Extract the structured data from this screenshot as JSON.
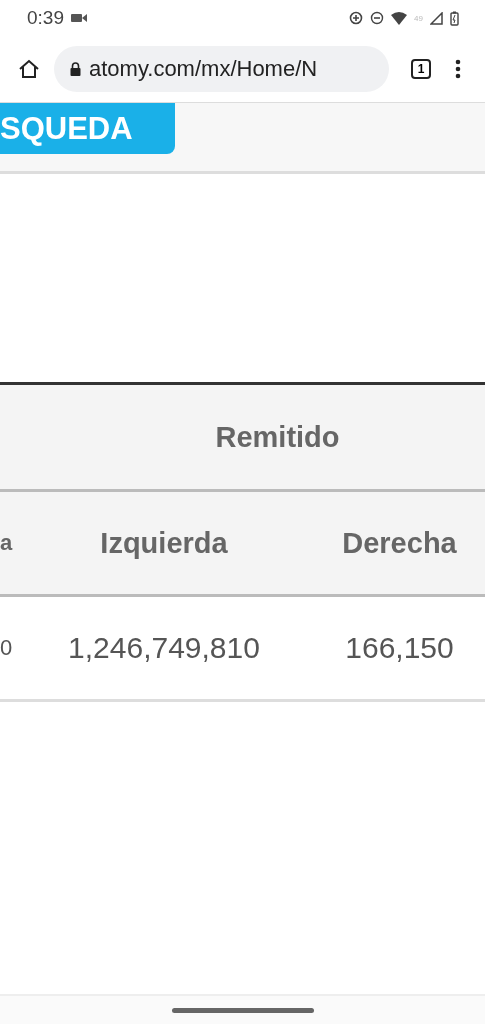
{
  "status_bar": {
    "time": "0:39",
    "signal_label": "49"
  },
  "browser": {
    "url": "atomy.com/mx/Home/N",
    "tab_count": "1"
  },
  "search_button": {
    "label": "SQUEDA"
  },
  "table": {
    "group_header": "Remitido",
    "columns": [
      "a",
      "Izquierda",
      "Derecha"
    ],
    "rows": [
      [
        "0",
        "1,246,749,810",
        "166,150"
      ]
    ]
  }
}
